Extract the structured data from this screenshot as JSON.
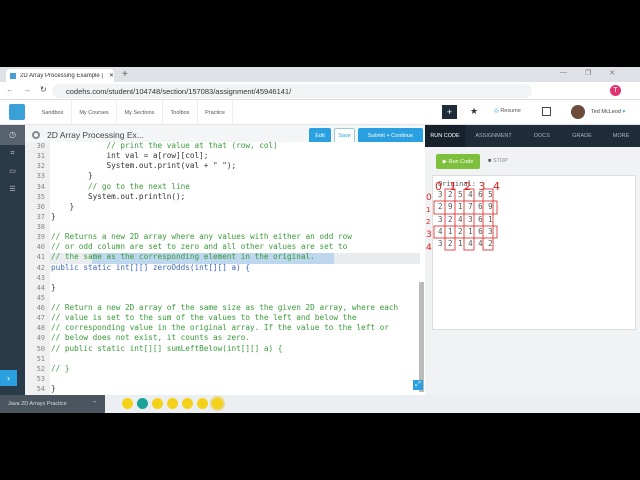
{
  "browser": {
    "tab_title": "2D Array Processing Example | C",
    "url": "codehs.com/student/104748/section/157083/assignment/45946141/",
    "profile_initial": "T"
  },
  "nav": {
    "items": [
      "Sandbox",
      "My Courses",
      "My Sections",
      "Toolbox",
      "Practice"
    ],
    "resume": "Resume",
    "user": "Ted McLeod"
  },
  "toolbar": {
    "title": "2D Array Processing Ex...",
    "edit": "Edit",
    "save": "Save",
    "submit": "Submit + Continue"
  },
  "editor": {
    "lines": [
      {
        "n": "30",
        "t": "            // print the value at that (row, col)",
        "c": "cm"
      },
      {
        "n": "31",
        "t": "            int val = a[row][col];",
        "c": ""
      },
      {
        "n": "32",
        "t": "            System.out.print(val + \" \");",
        "c": ""
      },
      {
        "n": "33",
        "t": "        }",
        "c": ""
      },
      {
        "n": "34",
        "t": "        // go to the next line",
        "c": "cm"
      },
      {
        "n": "35",
        "t": "        System.out.println();",
        "c": ""
      },
      {
        "n": "36",
        "t": "    }",
        "c": ""
      },
      {
        "n": "37",
        "t": "}",
        "c": ""
      },
      {
        "n": "38",
        "t": "",
        "c": ""
      },
      {
        "n": "39",
        "t": "// Returns a new 2D array where any values with either an odd row",
        "c": "cm"
      },
      {
        "n": "40",
        "t": "// or odd column are set to zero and all other values are set to",
        "c": "cm"
      },
      {
        "n": "41",
        "t": "// the same as the corresponding element in the original.",
        "c": "cm"
      },
      {
        "n": "42",
        "t": "public static int[][] zeroOdds(int[][] a) {",
        "c": "kw"
      },
      {
        "n": "43",
        "t": "",
        "c": ""
      },
      {
        "n": "44",
        "t": "}",
        "c": ""
      },
      {
        "n": "45",
        "t": "",
        "c": ""
      },
      {
        "n": "46",
        "t": "// Return a new 2D array of the same size as the given 2D array, where each",
        "c": "cm"
      },
      {
        "n": "47",
        "t": "// value is set to the sum of the values to the left and below the",
        "c": "cm"
      },
      {
        "n": "48",
        "t": "// corresponding value in the original array. If the value to the left or",
        "c": "cm"
      },
      {
        "n": "49",
        "t": "// below does not exist, it counts as zero.",
        "c": "cm"
      },
      {
        "n": "50",
        "t": "// public static int[][] sumLeftBelow(int[][] a) {",
        "c": "cm"
      },
      {
        "n": "51",
        "t": "",
        "c": ""
      },
      {
        "n": "52",
        "t": "// }",
        "c": "cm"
      },
      {
        "n": "53",
        "t": "",
        "c": ""
      },
      {
        "n": "54",
        "t": "}",
        "c": ""
      }
    ]
  },
  "right": {
    "tabs": [
      "RUN CODE",
      "ASSIGNMENT",
      "DOCS",
      "GRADE",
      "MORE"
    ],
    "run": "Run Code",
    "stop": "STOP",
    "output_label": "Original:",
    "output_rows": [
      "3 2 5 4 6 5",
      "2 9 1 7 6 9",
      "3 2 4 3 6 1",
      "4 1 2 1 6 3",
      "3 2 1 4 4 2"
    ],
    "annotations": {
      "cols": "0 1 2 3 4 5",
      "rows": [
        "0",
        "1",
        "2",
        "3",
        "4"
      ]
    }
  },
  "bottom": {
    "label": "Java 2D Arrays Practice"
  },
  "colors": {
    "accent": "#2aa0e0",
    "run": "#7dc03c",
    "dark": "#1e2b38"
  }
}
